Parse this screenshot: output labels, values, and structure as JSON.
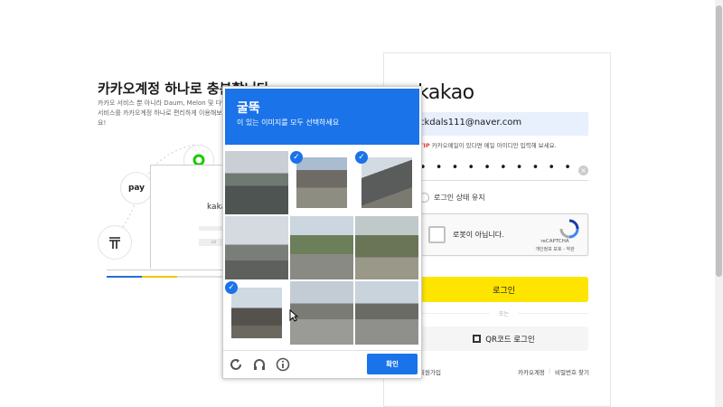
{
  "promo": {
    "title": "카카오계정 하나로 충분합니다",
    "desc": "카카오 서비스 뿐 아니라 Daum, Melon 및 다양한 서비스를 카카오계정 하나로 편리하게 이용해보세요!",
    "pay_label": "pay",
    "laptop_text": "kakao",
    "laptop_btn": "LO"
  },
  "login": {
    "logo": "kakao",
    "email_value": "ckdals111@naver.com",
    "tip_prefix": "TIP",
    "tip_text": "카카오메일이 있다면 메일 아이디만 입력해 보세요.",
    "password_mask": "• • • • • • • • • •",
    "stay_label": "로그인 상태 유지",
    "recaptcha_label": "로봇이 아닙니다.",
    "recaptcha_brand": "reCAPTCHA",
    "recaptcha_links": "개인정보 보호 - 약관",
    "login_button": "로그인",
    "or_text": "또는",
    "qr_button": "QR코드 로그인",
    "signup": "회원가입",
    "find_account": "카카오계정",
    "find_password": "비밀번호 찾기"
  },
  "challenge": {
    "title": "굴뚝",
    "subtitle": "이 있는 이미지를 모두 선택하세요",
    "verify_button": "확인",
    "tiles": [
      {
        "selected": false
      },
      {
        "selected": true
      },
      {
        "selected": true
      },
      {
        "selected": false
      },
      {
        "selected": false
      },
      {
        "selected": false
      },
      {
        "selected": true
      },
      {
        "selected": false
      },
      {
        "selected": false
      }
    ]
  },
  "colors": {
    "kakao_yellow": "#fee500",
    "recaptcha_blue": "#1a73e8"
  }
}
